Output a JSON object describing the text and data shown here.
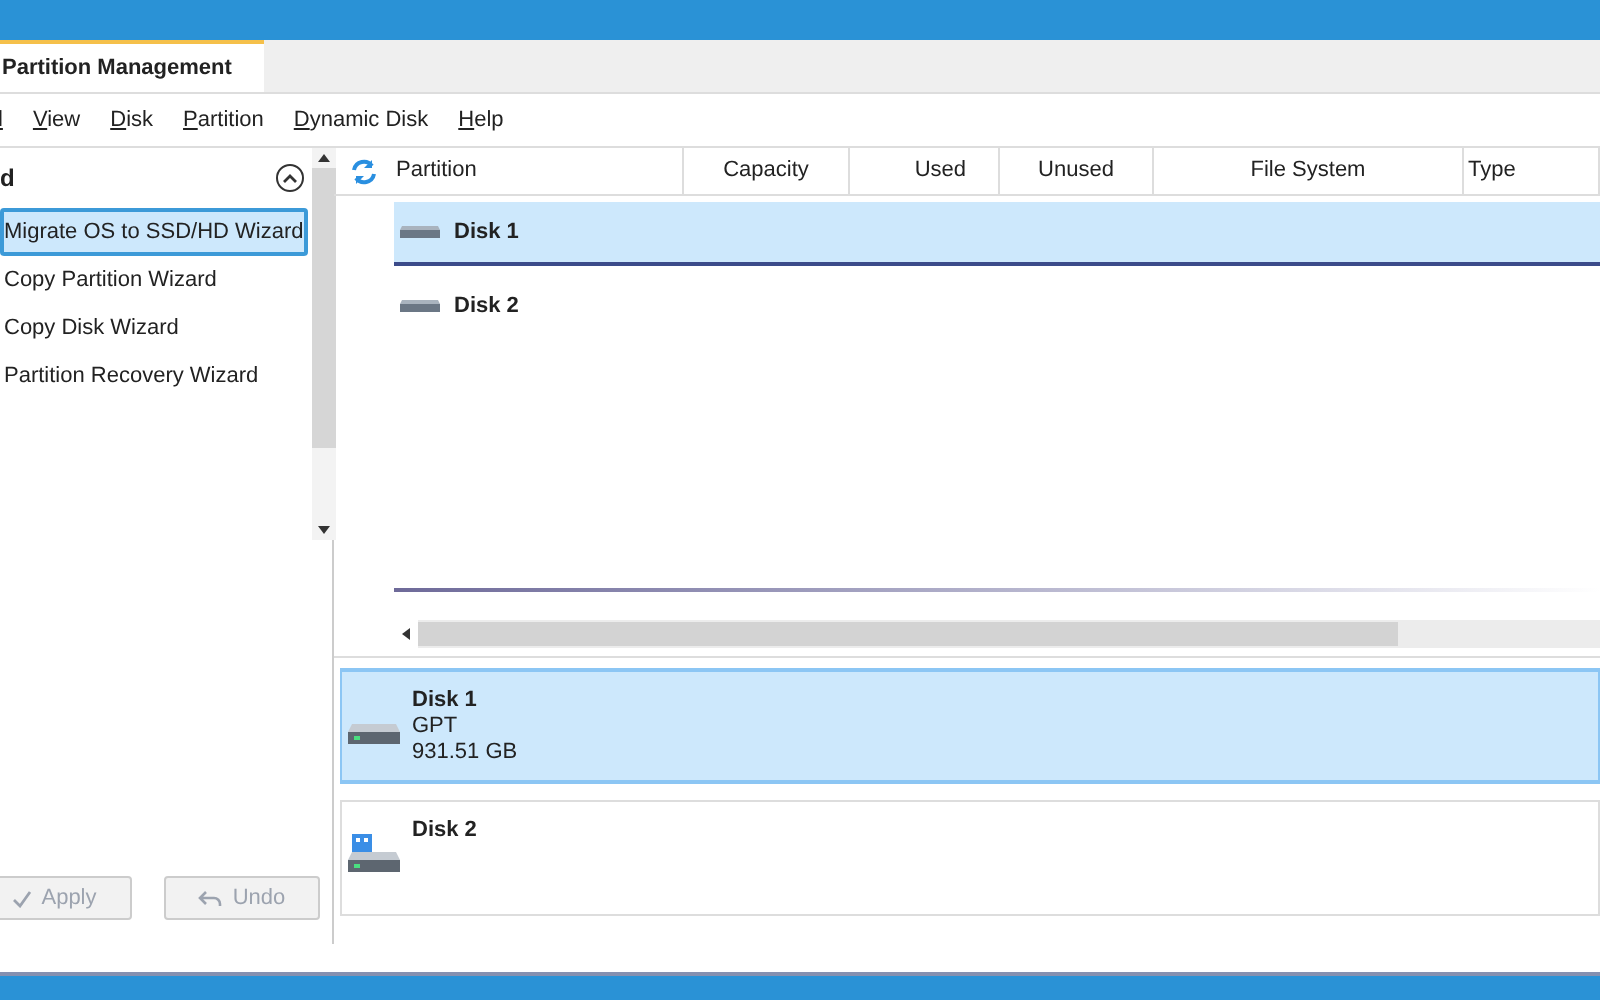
{
  "tabs": [
    {
      "label": "Partition Management",
      "selected": true
    }
  ],
  "menu": [
    {
      "label": "l"
    },
    {
      "label": "View"
    },
    {
      "label": "Disk"
    },
    {
      "label": "Partition"
    },
    {
      "label": "Dynamic Disk"
    },
    {
      "label": "Help"
    }
  ],
  "sidebar": {
    "header": "d",
    "expanded": true,
    "items": [
      {
        "label": "Migrate OS to SSD/HD Wizard",
        "selected": true
      },
      {
        "label": "Copy Partition Wizard",
        "selected": false
      },
      {
        "label": "Copy Disk Wizard",
        "selected": false
      },
      {
        "label": "Partition Recovery Wizard",
        "selected": false
      }
    ]
  },
  "buttons": [
    {
      "kind": "apply",
      "label": "Apply",
      "disabled": true
    },
    {
      "kind": "undo",
      "label": "Undo",
      "disabled": true
    }
  ],
  "table": {
    "columns": [
      "Partition",
      "Capacity",
      "Used",
      "Unused",
      "File System",
      "Type"
    ],
    "rows": [
      {
        "partition": "Disk 1",
        "selected": true
      },
      {
        "partition": "Disk 2",
        "selected": false
      }
    ]
  },
  "disk_map": [
    {
      "kind": "hdd",
      "name": "Disk 1",
      "lines": [
        "GPT",
        "931.51 GB"
      ],
      "selected": true
    },
    {
      "kind": "usb",
      "name": "Disk 2",
      "selected": false
    }
  ]
}
